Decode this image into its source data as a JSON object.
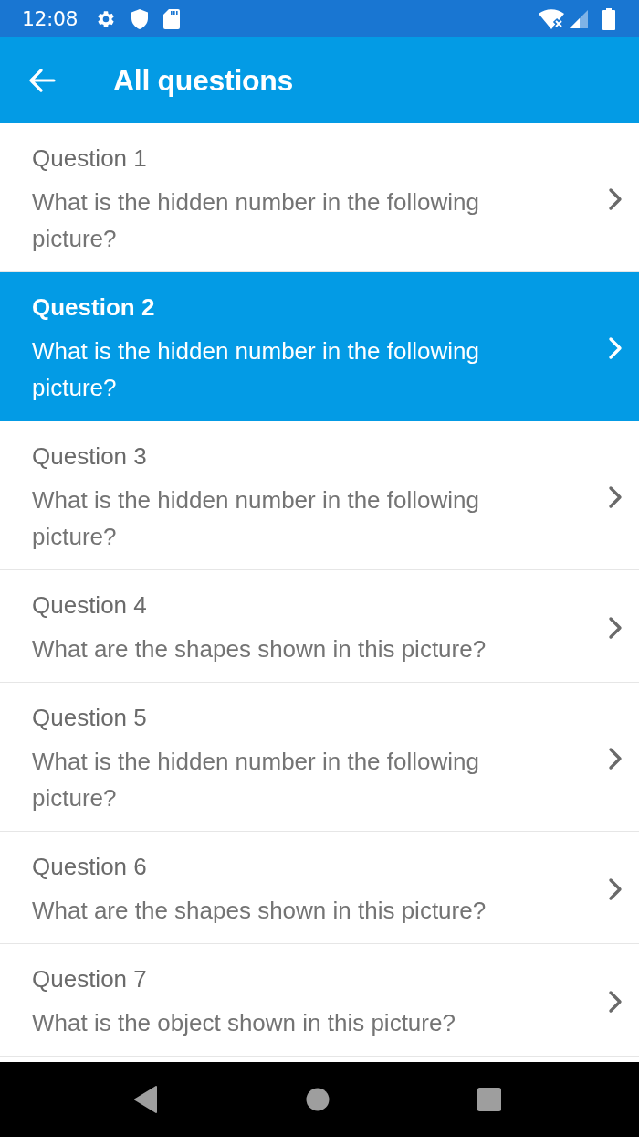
{
  "status_bar": {
    "time": "12:08"
  },
  "app_bar": {
    "title": "All questions"
  },
  "questions": [
    {
      "title": "Question 1",
      "text": "What is the hidden number in the following picture?",
      "selected": false
    },
    {
      "title": "Question 2",
      "text": "What is the hidden number in the following picture?",
      "selected": true
    },
    {
      "title": "Question 3",
      "text": "What is the hidden number in the following picture?",
      "selected": false
    },
    {
      "title": "Question 4",
      "text": "What are the shapes shown in this picture?",
      "selected": false
    },
    {
      "title": "Question 5",
      "text": "What is the hidden number in the following picture?",
      "selected": false
    },
    {
      "title": "Question 6",
      "text": "What are the shapes shown in this picture?",
      "selected": false
    },
    {
      "title": "Question 7",
      "text": "What is the object shown in this picture?",
      "selected": false
    }
  ]
}
